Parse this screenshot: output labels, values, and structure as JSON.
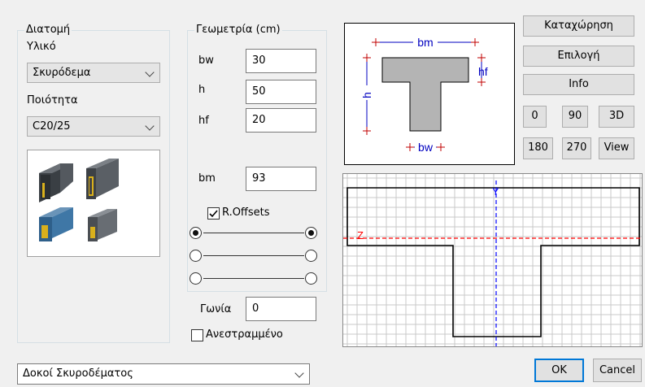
{
  "section": {
    "legend": "Διατομή",
    "material_label": "Υλικό",
    "material_value": "Σκυρόδεμα",
    "quality_label": "Ποιότητα",
    "quality_value": "C20/25"
  },
  "geometry": {
    "legend": "Γεωμετρία (cm)",
    "fields": [
      {
        "label": "bw",
        "value": "30"
      },
      {
        "label": "h",
        "value": "50"
      },
      {
        "label": "hf",
        "value": "20"
      },
      {
        "label": "bm",
        "value": "93"
      }
    ],
    "roffsets_label": "R.Offsets",
    "roffsets_checked": true
  },
  "angle": {
    "label": "Γωνία",
    "value": "0"
  },
  "reversed": {
    "label": "Ανεστραμμένο",
    "checked": false
  },
  "preview": {
    "bm": "bm",
    "hf": "hf",
    "h": "h",
    "bw": "bw"
  },
  "grid_axes": {
    "y": "Y",
    "z": "Z"
  },
  "buttons": {
    "register": "Καταχώρηση",
    "select": "Επιλογή",
    "info": "Info",
    "v0": "0",
    "v90": "90",
    "v3d": "3D",
    "v180": "180",
    "v270": "270",
    "view": "View",
    "ok": "OK",
    "cancel": "Cancel"
  },
  "bottom_combo": "Δοκοί Σκυροδέματος",
  "colors": {
    "section_fill": "#b4b4b4",
    "dimension_blue": "#0000c0",
    "dimension_red": "#c00000",
    "grid_line": "#c8c8c8",
    "axis_y": "#0000ff",
    "axis_z": "#ff0000"
  }
}
